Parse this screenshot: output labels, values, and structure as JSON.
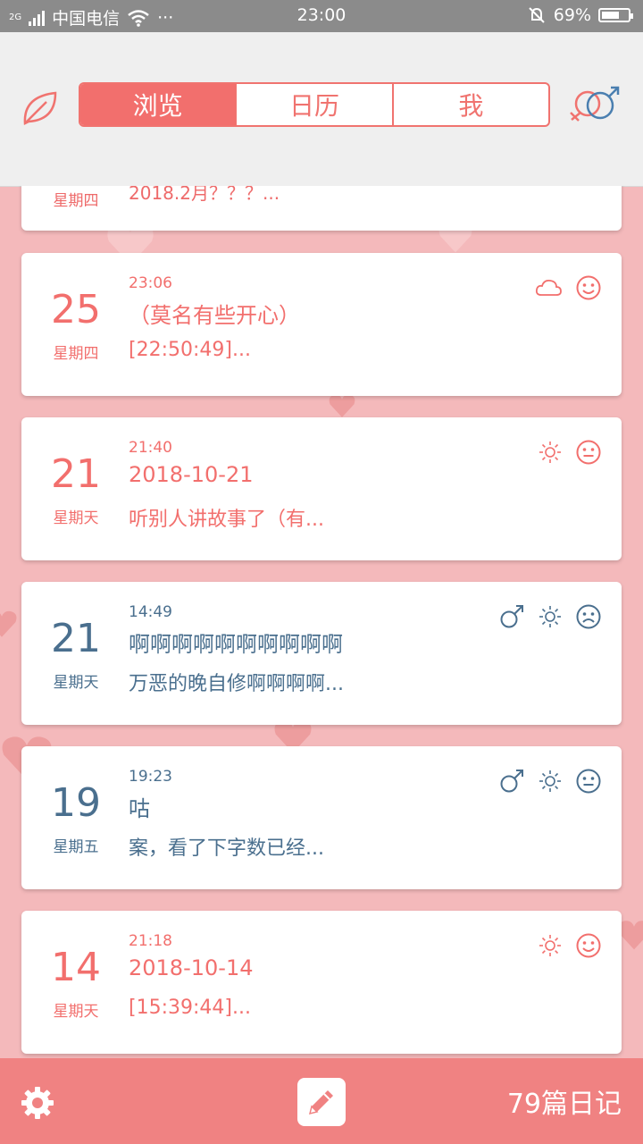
{
  "status_bar": {
    "network": "2G",
    "carrier": "中国电信",
    "more": "···",
    "time": "23:00",
    "battery": "69%",
    "battery_level": 0.69
  },
  "header": {
    "tabs": [
      {
        "label": "浏览",
        "active": true
      },
      {
        "label": "日历",
        "active": false
      },
      {
        "label": "我",
        "active": false
      }
    ]
  },
  "partial_entry": {
    "weekday": "星期四",
    "text": "2018.2月？？？..."
  },
  "entries": [
    {
      "day": "25",
      "weekday": "星期四",
      "time": "23:06",
      "title": "（莫名有些开心）",
      "snippet": "[22:50:49]...",
      "theme": "red",
      "weather": "cloudy-icon",
      "mood": "happy-face-icon",
      "gender": ""
    },
    {
      "day": "21",
      "weekday": "星期天",
      "time": "21:40",
      "title": "2018-10-21",
      "snippet": "听别人讲故事了（有...",
      "theme": "red",
      "weather": "sun-icon",
      "mood": "neutral-face-icon",
      "gender": ""
    },
    {
      "day": "21",
      "weekday": "星期天",
      "time": "14:49",
      "title": "啊啊啊啊啊啊啊啊啊啊",
      "snippet": "万恶的晚自修啊啊啊啊...",
      "theme": "blue",
      "weather": "sun-icon",
      "mood": "sad-face-icon",
      "gender": "male-icon"
    },
    {
      "day": "19",
      "weekday": "星期五",
      "time": "19:23",
      "title": "咕",
      "snippet": "案，看了下字数已经...",
      "theme": "blue",
      "weather": "sun-icon",
      "mood": "neutral-face-icon",
      "gender": "male-icon"
    },
    {
      "day": "14",
      "weekday": "星期天",
      "time": "21:18",
      "title": "2018-10-14",
      "snippet": "[15:39:44]...",
      "theme": "red",
      "weather": "sun-icon",
      "mood": "happy-face-icon",
      "gender": ""
    }
  ],
  "footer": {
    "count_label": "79篇日记"
  },
  "colors": {
    "accent": "#f26f6d",
    "blue_text": "#4a6f8e",
    "bottom_bar": "#f08282",
    "background": "#f4b9bb"
  }
}
